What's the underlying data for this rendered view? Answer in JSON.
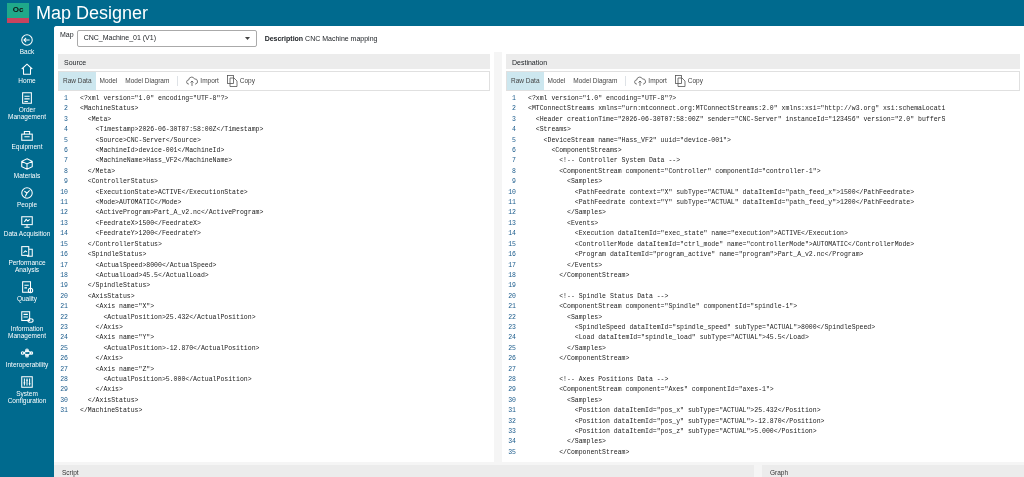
{
  "app": {
    "logo": "Oc",
    "title": "Map Designer"
  },
  "sidebar": {
    "items": [
      {
        "label": "Back"
      },
      {
        "label": "Home"
      },
      {
        "label": "Order Management"
      },
      {
        "label": "Equipment"
      },
      {
        "label": "Materials"
      },
      {
        "label": "People"
      },
      {
        "label": "Data Acquisition"
      },
      {
        "label": "Performance Analysis"
      },
      {
        "label": "Quality"
      },
      {
        "label": "Information Management"
      },
      {
        "label": "Interoperability"
      },
      {
        "label": "System Configuration"
      }
    ]
  },
  "map": {
    "label": "Map",
    "value": "CNC_Machine_01 (V1)",
    "description_label": "Description",
    "description": "CNC Machine mapping"
  },
  "panels": [
    {
      "title": "Source",
      "tabs": [
        {
          "label": "Raw Data",
          "selected": true
        },
        {
          "label": "Model",
          "selected": false
        },
        {
          "label": "Model Diagram",
          "selected": false
        }
      ],
      "actions": [
        "Import",
        "Copy"
      ],
      "lines": [
        {
          "number": "1",
          "text": "<?xml version=\"1.0\" encoding=\"UTF-8\"?>"
        },
        {
          "number": "2",
          "text": "<MachineStatus>"
        },
        {
          "number": "3",
          "text": "  <Meta>"
        },
        {
          "number": "4",
          "text": "    <Timestamp>2026-06-30T07:58:00Z</Timestamp>"
        },
        {
          "number": "5",
          "text": "    <Source>CNC-Server</Source>"
        },
        {
          "number": "6",
          "text": "    <MachineId>device-001</MachineId>"
        },
        {
          "number": "7",
          "text": "    <MachineName>Hass_VF2</MachineName>"
        },
        {
          "number": "8",
          "text": "  </Meta>"
        },
        {
          "number": "9",
          "text": "  <ControllerStatus>"
        },
        {
          "number": "10",
          "text": "    <ExecutionState>ACTIVE</ExecutionState>"
        },
        {
          "number": "11",
          "text": "    <Mode>AUTOMATIC</Mode>"
        },
        {
          "number": "12",
          "text": "    <ActiveProgram>Part_A_v2.nc</ActiveProgram>"
        },
        {
          "number": "13",
          "text": "    <FeedrateX>1500</FeedrateX>"
        },
        {
          "number": "14",
          "text": "    <FeedrateY>1200</FeedrateY>"
        },
        {
          "number": "15",
          "text": "  </ControllerStatus>"
        },
        {
          "number": "16",
          "text": "  <SpindleStatus>"
        },
        {
          "number": "17",
          "text": "    <ActualSpeed>8000</ActualSpeed>"
        },
        {
          "number": "18",
          "text": "    <ActualLoad>45.5</ActualLoad>"
        },
        {
          "number": "19",
          "text": "  </SpindleStatus>"
        },
        {
          "number": "20",
          "text": "  <AxisStatus>"
        },
        {
          "number": "21",
          "text": "    <Axis name=\"X\">"
        },
        {
          "number": "22",
          "text": "      <ActualPosition>25.432</ActualPosition>"
        },
        {
          "number": "23",
          "text": "    </Axis>"
        },
        {
          "number": "24",
          "text": "    <Axis name=\"Y\">"
        },
        {
          "number": "25",
          "text": "      <ActualPosition>-12.870</ActualPosition>"
        },
        {
          "number": "26",
          "text": "    </Axis>"
        },
        {
          "number": "27",
          "text": "    <Axis name=\"Z\">"
        },
        {
          "number": "28",
          "text": "      <ActualPosition>5.000</ActualPosition>"
        },
        {
          "number": "29",
          "text": "    </Axis>"
        },
        {
          "number": "30",
          "text": "  </AxisStatus>"
        },
        {
          "number": "31",
          "text": "</MachineStatus>"
        }
      ]
    },
    {
      "title": "Destination",
      "tabs": [
        {
          "label": "Raw Data",
          "selected": true
        },
        {
          "label": "Model",
          "selected": false
        },
        {
          "label": "Model Diagram",
          "selected": false
        }
      ],
      "actions": [
        "Import",
        "Copy"
      ],
      "lines": [
        {
          "number": "1",
          "text": "<?xml version=\"1.0\" encoding=\"UTF-8\"?>"
        },
        {
          "number": "2",
          "text": "<MTConnectStreams xmlns=\"urn:mtconnect.org:MTConnectStreams:2.0\" xmlns:xsi=\"http://w3.org\" xsi:schemaLocati"
        },
        {
          "number": "3",
          "text": "  <Header creationTime=\"2026-06-30T07:58:00Z\" sender=\"CNC-Server\" instanceId=\"123456\" version=\"2.0\" bufferS"
        },
        {
          "number": "4",
          "text": "  <Streams>"
        },
        {
          "number": "5",
          "text": "    <DeviceStream name=\"Hass_VF2\" uuid=\"device-001\">"
        },
        {
          "number": "6",
          "text": "      <ComponentStreams>"
        },
        {
          "number": "7",
          "text": "        <!-- Controller System Data -->"
        },
        {
          "number": "8",
          "text": "        <ComponentStream component=\"Controller\" componentId=\"controller-1\">"
        },
        {
          "number": "9",
          "text": "          <Samples>"
        },
        {
          "number": "10",
          "text": "            <PathFeedrate context=\"X\" subType=\"ACTUAL\" dataItemId=\"path_feed_x\">1500</PathFeedrate>"
        },
        {
          "number": "11",
          "text": "            <PathFeedrate context=\"Y\" subType=\"ACTUAL\" dataItemId=\"path_feed_y\">1200</PathFeedrate>"
        },
        {
          "number": "12",
          "text": "          </Samples>"
        },
        {
          "number": "13",
          "text": "          <Events>"
        },
        {
          "number": "14",
          "text": "            <Execution dataItemId=\"exec_state\" name=\"execution\">ACTIVE</Execution>"
        },
        {
          "number": "15",
          "text": "            <ControllerMode dataItemId=\"ctrl_mode\" name=\"controllerMode\">AUTOMATIC</ControllerMode>"
        },
        {
          "number": "16",
          "text": "            <Program dataItemId=\"program_active\" name=\"program\">Part_A_v2.nc</Program>"
        },
        {
          "number": "17",
          "text": "          </Events>"
        },
        {
          "number": "18",
          "text": "        </ComponentStream>"
        },
        {
          "number": "19"
        },
        {
          "number": "20",
          "text": "        <!-- Spindle Status Data -->"
        },
        {
          "number": "21",
          "text": "        <ComponentStream component=\"Spindle\" componentId=\"spindle-1\">"
        },
        {
          "number": "22",
          "text": "          <Samples>"
        },
        {
          "number": "23",
          "text": "            <SpindleSpeed dataItemId=\"spindle_speed\" subType=\"ACTUAL\">8000</SpindleSpeed>"
        },
        {
          "number": "24",
          "text": "            <Load dataItemId=\"spindle_load\" subType=\"ACTUAL\">45.5</Load>"
        },
        {
          "number": "25",
          "text": "          </Samples>"
        },
        {
          "number": "26",
          "text": "        </ComponentStream>"
        },
        {
          "number": "27"
        },
        {
          "number": "28",
          "text": "        <!-- Axes Positions Data -->"
        },
        {
          "number": "29",
          "text": "        <ComponentStream component=\"Axes\" componentId=\"axes-1\">"
        },
        {
          "number": "30",
          "text": "          <Samples>"
        },
        {
          "number": "31",
          "text": "            <Position dataItemId=\"pos_x\" subType=\"ACTUAL\">25.432</Position>"
        },
        {
          "number": "32",
          "text": "            <Position dataItemId=\"pos_y\" subType=\"ACTUAL\">-12.870</Position>"
        },
        {
          "number": "33",
          "text": "            <Position dataItemId=\"pos_z\" subType=\"ACTUAL\">5.000</Position>"
        },
        {
          "number": "34",
          "text": "          </Samples>"
        },
        {
          "number": "35",
          "text": "        </ComponentStream>"
        }
      ]
    }
  ],
  "bottom_panels": [
    {
      "title": "Script"
    },
    {
      "title": "Graph"
    }
  ]
}
